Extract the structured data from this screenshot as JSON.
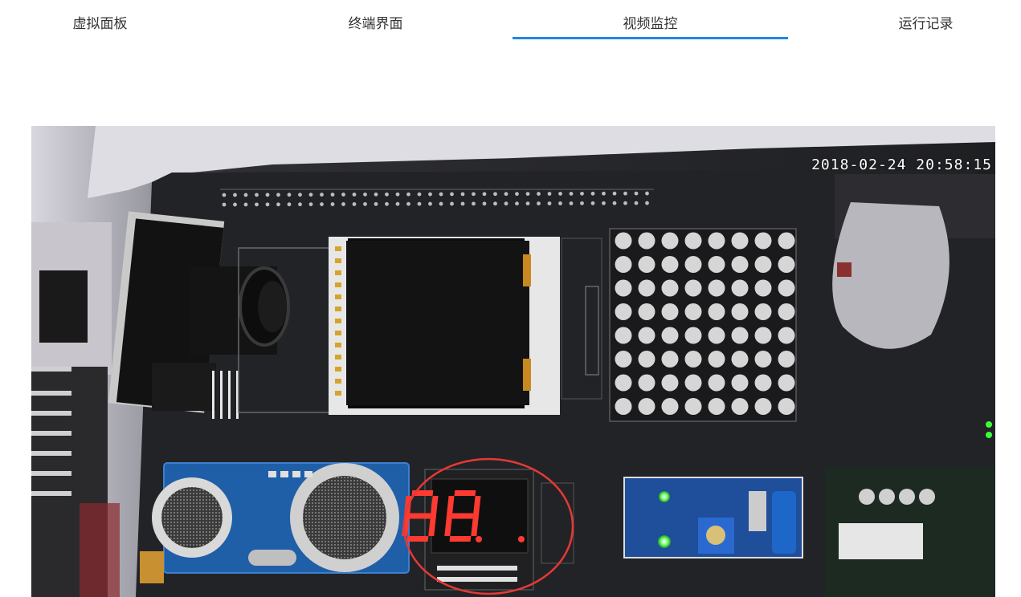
{
  "tabs": [
    {
      "label": "虚拟面板",
      "active": false
    },
    {
      "label": "终端界面",
      "active": false
    },
    {
      "label": "视频监控",
      "active": true
    },
    {
      "label": "运行记录",
      "active": false
    }
  ],
  "video": {
    "timestamp": "2018-02-24 20:58:15",
    "segment_display": "8.8.",
    "accent_color": "#1e88e5",
    "highlight_color": "#e53935"
  }
}
